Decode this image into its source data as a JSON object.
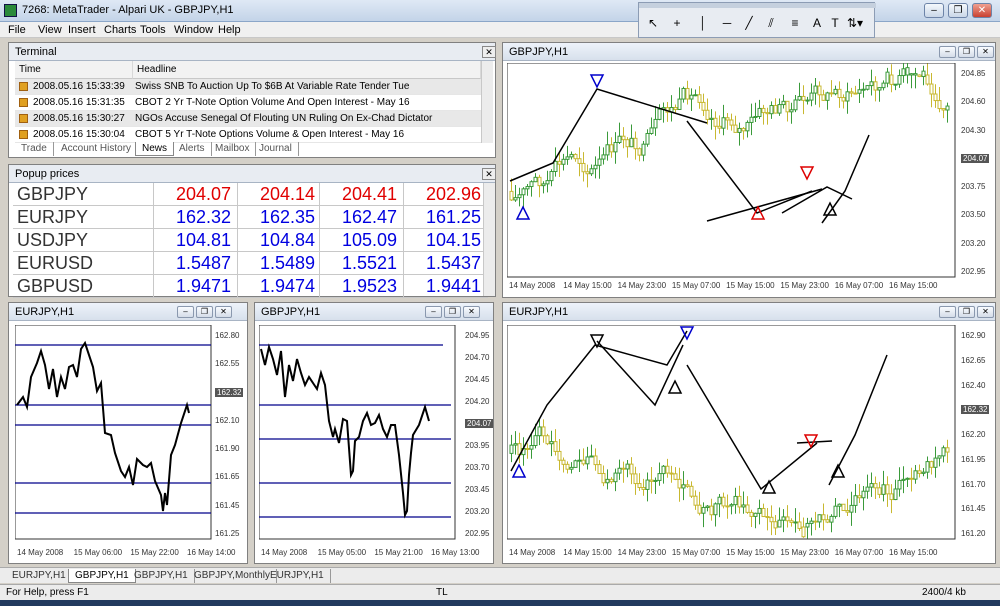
{
  "window": {
    "title": "7268: MetaTrader - Alpari UK - GBPJPY,H1"
  },
  "menu": [
    "File",
    "View",
    "Insert",
    "Charts",
    "Tools",
    "Window",
    "Help"
  ],
  "terminal": {
    "title": "Terminal",
    "columns": [
      "Time",
      "Headline"
    ],
    "rows": [
      {
        "time": "2008.05.16 15:33:39",
        "headline": "Swiss SNB To Auction Up To $6B At Variable Rate Tender Tue"
      },
      {
        "time": "2008.05.16 15:31:35",
        "headline": "CBOT 2 Yr T-Note Option Volume And Open Interest - May 16"
      },
      {
        "time": "2008.05.16 15:30:27",
        "headline": "NGOs Accuse Senegal Of Flouting UN Ruling On Ex-Chad Dictator"
      },
      {
        "time": "2008.05.16 15:30:04",
        "headline": "CBOT 5 Yr T-Note Options Volume & Open Interest - May 16"
      }
    ],
    "tabs": [
      "Trade",
      "Account History",
      "News",
      "Alerts",
      "Mailbox",
      "Journal"
    ],
    "active_tab": "News"
  },
  "popup": {
    "title": "Popup prices",
    "rows": [
      {
        "symbol": "GBPJPY",
        "v1": "204.07",
        "v2": "204.14",
        "v3": "204.41",
        "v4": "202.96",
        "color": "#e00000"
      },
      {
        "symbol": "EURJPY",
        "v1": "162.32",
        "v2": "162.35",
        "v3": "162.47",
        "v4": "161.25",
        "color": "#0000e0"
      },
      {
        "symbol": "USDJPY",
        "v1": "104.81",
        "v2": "104.84",
        "v3": "105.09",
        "v4": "104.15",
        "color": "#0000e0"
      },
      {
        "symbol": "EURUSD",
        "v1": "1.5487",
        "v2": "1.5489",
        "v3": "1.5521",
        "v4": "1.5437",
        "color": "#0000e0"
      },
      {
        "symbol": "GBPUSD",
        "v1": "1.9471",
        "v2": "1.9474",
        "v3": "1.9523",
        "v4": "1.9441",
        "color": "#0000e0"
      }
    ]
  },
  "charts": {
    "gbp_top": {
      "title": "GBPJPY,H1",
      "yticks": [
        "204.85",
        "204.60",
        "204.30",
        "204.07",
        "203.75",
        "203.50",
        "203.20",
        "202.95"
      ],
      "price_tag": "204.07",
      "xticks": [
        "14 May 2008",
        "14 May 15:00",
        "14 May 23:00",
        "15 May 07:00",
        "15 May 15:00",
        "15 May 23:00",
        "16 May 07:00",
        "16 May 15:00"
      ]
    },
    "eur_line": {
      "title": "EURJPY,H1",
      "yticks": [
        "162.80",
        "162.55",
        "162.32",
        "162.10",
        "161.90",
        "161.65",
        "161.45",
        "161.25"
      ],
      "price_tag": "162.32",
      "xticks": [
        "14 May 2008",
        "15 May 06:00",
        "15 May 22:00",
        "16 May 14:00"
      ]
    },
    "gbp_line": {
      "title": "GBPJPY,H1",
      "yticks": [
        "204.95",
        "204.70",
        "204.45",
        "204.20",
        "204.07",
        "203.95",
        "203.70",
        "203.45",
        "203.20",
        "202.95"
      ],
      "price_tag": "204.07",
      "xticks": [
        "14 May 2008",
        "15 May 05:00",
        "15 May 21:00",
        "16 May 13:00"
      ]
    },
    "eur_bottom": {
      "title": "EURJPY,H1",
      "yticks": [
        "162.90",
        "162.65",
        "162.40",
        "162.32",
        "162.20",
        "161.95",
        "161.70",
        "161.45",
        "161.20"
      ],
      "price_tag": "162.32",
      "xticks": [
        "14 May 2008",
        "14 May 15:00",
        "14 May 23:00",
        "15 May 07:00",
        "15 May 15:00",
        "15 May 23:00",
        "16 May 07:00",
        "16 May 15:00"
      ]
    }
  },
  "bottom_tabs": [
    "EURJPY,H1",
    "GBPJPY,H1",
    "GBPJPY,H1",
    "GBPJPY,Monthly",
    "EURJPY,H1"
  ],
  "active_bottom_tab": "GBPJPY,H1",
  "status": {
    "help": "For Help, press F1",
    "mode": "TL",
    "traffic": "2400/4 kb"
  }
}
